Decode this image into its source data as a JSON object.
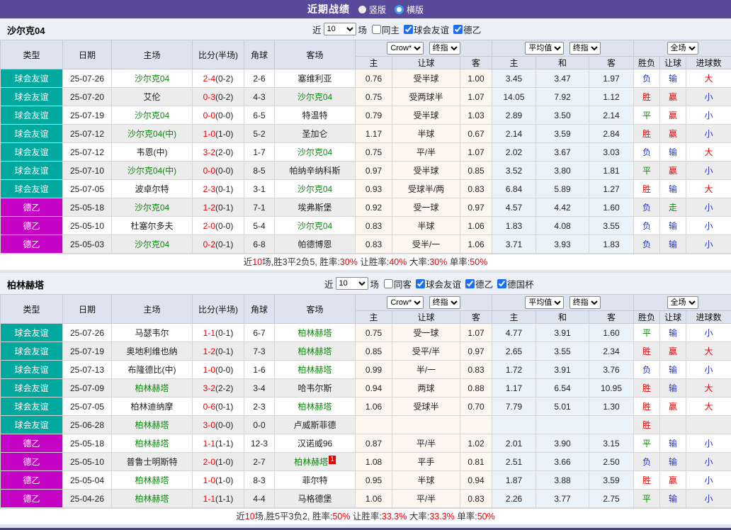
{
  "topbar": {
    "title": "近期战绩",
    "radio_vertical": "竖版",
    "radio_horizontal": "横版"
  },
  "controls": {
    "near_label": "近",
    "games_label": "场"
  },
  "table_header": {
    "cols": [
      "类型",
      "日期",
      "主场",
      "比分(半场)",
      "角球",
      "客场"
    ],
    "sub": [
      "主",
      "让球",
      "客",
      "主",
      "和",
      "客",
      "胜负",
      "让球",
      "进球数"
    ],
    "selects": {
      "provider": "Crow*",
      "final1": "终指",
      "average": "平均值",
      "final2": "终指",
      "scope": "全场"
    }
  },
  "league_colors": {
    "球会友谊": "#00a89d",
    "德乙": "#c503c5"
  },
  "result_colors": {
    "胜": "#e60000",
    "赢": "#e60000",
    "大": "#e60000",
    "负": "#2233cc",
    "输": "#2233cc",
    "小": "#2233cc",
    "平": "#088a08",
    "走": "#088a08"
  },
  "sections": [
    {
      "team": "沙尔克04",
      "recent_count": "10",
      "filters": [
        {
          "label": "同主",
          "checked": false
        },
        {
          "label": "球会友谊",
          "checked": true
        },
        {
          "label": "德乙",
          "checked": true
        }
      ],
      "rows": [
        {
          "league": "球会友谊",
          "date": "25-07-26",
          "home": "沙尔克04",
          "hg": true,
          "score": "2-4",
          "half": "(0-2)",
          "corner": "2-6",
          "away": "塞维利亚",
          "ag": false,
          "odds": [
            "0.76",
            "受半球",
            "1.00",
            "3.45",
            "3.47",
            "1.97"
          ],
          "res": [
            "负",
            "输",
            "大"
          ]
        },
        {
          "league": "球会友谊",
          "date": "25-07-20",
          "home": "艾伦",
          "hg": false,
          "score": "0-3",
          "half": "(0-2)",
          "corner": "4-3",
          "away": "沙尔克04",
          "ag": true,
          "odds": [
            "0.75",
            "受两球半",
            "1.07",
            "14.05",
            "7.92",
            "1.12"
          ],
          "res": [
            "胜",
            "赢",
            "小"
          ]
        },
        {
          "league": "球会友谊",
          "date": "25-07-19",
          "home": "沙尔克04",
          "hg": true,
          "score": "0-0",
          "half": "(0-0)",
          "corner": "6-5",
          "away": "特温特",
          "ag": false,
          "odds": [
            "0.79",
            "受半球",
            "1.03",
            "2.89",
            "3.50",
            "2.14"
          ],
          "res": [
            "平",
            "赢",
            "小"
          ]
        },
        {
          "league": "球会友谊",
          "date": "25-07-12",
          "home": "沙尔克04(中)",
          "hg": true,
          "score": "1-0",
          "half": "(1-0)",
          "corner": "5-2",
          "away": "圣加仑",
          "ag": false,
          "odds": [
            "1.17",
            "半球",
            "0.67",
            "2.14",
            "3.59",
            "2.84"
          ],
          "res": [
            "胜",
            "赢",
            "小"
          ]
        },
        {
          "league": "球会友谊",
          "date": "25-07-12",
          "home": "韦恩(中)",
          "hg": false,
          "score": "3-2",
          "half": "(2-0)",
          "corner": "1-7",
          "away": "沙尔克04",
          "ag": true,
          "odds": [
            "0.75",
            "平/半",
            "1.07",
            "2.02",
            "3.67",
            "3.03"
          ],
          "res": [
            "负",
            "输",
            "大"
          ]
        },
        {
          "league": "球会友谊",
          "date": "25-07-10",
          "home": "沙尔克04(中)",
          "hg": true,
          "score": "0-0",
          "half": "(0-0)",
          "corner": "8-5",
          "away": "帕纳辛纳科斯",
          "ag": false,
          "odds": [
            "0.97",
            "受半球",
            "0.85",
            "3.52",
            "3.80",
            "1.81"
          ],
          "res": [
            "平",
            "赢",
            "小"
          ]
        },
        {
          "league": "球会友谊",
          "date": "25-07-05",
          "home": "波卓尔特",
          "hg": false,
          "score": "2-3",
          "half": "(0-1)",
          "corner": "3-1",
          "away": "沙尔克04",
          "ag": true,
          "odds": [
            "0.93",
            "受球半/两",
            "0.83",
            "6.84",
            "5.89",
            "1.27"
          ],
          "res": [
            "胜",
            "输",
            "大"
          ]
        },
        {
          "league": "德乙",
          "date": "25-05-18",
          "home": "沙尔克04",
          "hg": true,
          "score": "1-2",
          "half": "(0-1)",
          "corner": "7-1",
          "away": "埃弗斯堡",
          "ag": false,
          "odds": [
            "0.92",
            "受一球",
            "0.97",
            "4.57",
            "4.42",
            "1.60"
          ],
          "res": [
            "负",
            "走",
            "小"
          ]
        },
        {
          "league": "德乙",
          "date": "25-05-10",
          "home": "杜塞尔多夫",
          "hg": false,
          "score": "2-0",
          "half": "(0-0)",
          "corner": "5-4",
          "away": "沙尔克04",
          "ag": true,
          "odds": [
            "0.83",
            "半球",
            "1.06",
            "1.83",
            "4.08",
            "3.55"
          ],
          "res": [
            "负",
            "输",
            "小"
          ]
        },
        {
          "league": "德乙",
          "date": "25-05-03",
          "home": "沙尔克04",
          "hg": true,
          "score": "0-2",
          "half": "(0-1)",
          "corner": "6-8",
          "away": "帕德博恩",
          "ag": false,
          "odds": [
            "0.83",
            "受半/一",
            "1.06",
            "3.71",
            "3.93",
            "1.83"
          ],
          "res": [
            "负",
            "输",
            "小"
          ]
        }
      ],
      "summary": [
        [
          "近",
          0
        ],
        [
          "10",
          1
        ],
        [
          "场,胜3平2负5, 胜率:",
          0
        ],
        [
          "30%",
          1
        ],
        [
          " 让胜率:",
          0
        ],
        [
          "40%",
          1
        ],
        [
          " 大率:",
          0
        ],
        [
          "30%",
          1
        ],
        [
          " 单率:",
          0
        ],
        [
          "50%",
          1
        ]
      ]
    },
    {
      "team": "柏林赫塔",
      "recent_count": "10",
      "filters": [
        {
          "label": "同客",
          "checked": false
        },
        {
          "label": "球会友谊",
          "checked": true
        },
        {
          "label": "德乙",
          "checked": true
        },
        {
          "label": "德国杯",
          "checked": true
        }
      ],
      "rows": [
        {
          "league": "球会友谊",
          "date": "25-07-26",
          "home": "马瑟韦尔",
          "hg": false,
          "score": "1-1",
          "half": "(0-1)",
          "corner": "6-7",
          "away": "柏林赫塔",
          "ag": true,
          "odds": [
            "0.75",
            "受一球",
            "1.07",
            "4.77",
            "3.91",
            "1.60"
          ],
          "res": [
            "平",
            "输",
            "小"
          ]
        },
        {
          "league": "球会友谊",
          "date": "25-07-19",
          "home": "奥地利维也纳",
          "hg": false,
          "score": "1-2",
          "half": "(0-1)",
          "corner": "7-3",
          "away": "柏林赫塔",
          "ag": true,
          "odds": [
            "0.85",
            "受平/半",
            "0.97",
            "2.65",
            "3.55",
            "2.34"
          ],
          "res": [
            "胜",
            "赢",
            "大"
          ]
        },
        {
          "league": "球会友谊",
          "date": "25-07-13",
          "home": "布隆德比(中)",
          "hg": false,
          "score": "1-0",
          "half": "(0-0)",
          "corner": "1-6",
          "away": "柏林赫塔",
          "ag": true,
          "odds": [
            "0.99",
            "半/一",
            "0.83",
            "1.72",
            "3.91",
            "3.76"
          ],
          "res": [
            "负",
            "输",
            "小"
          ]
        },
        {
          "league": "球会友谊",
          "date": "25-07-09",
          "home": "柏林赫塔",
          "hg": true,
          "score": "3-2",
          "half": "(2-2)",
          "corner": "3-4",
          "away": "哈韦尔斯",
          "ag": false,
          "odds": [
            "0.94",
            "两球",
            "0.88",
            "1.17",
            "6.54",
            "10.95"
          ],
          "res": [
            "胜",
            "输",
            "大"
          ]
        },
        {
          "league": "球会友谊",
          "date": "25-07-05",
          "home": "柏林迪纳摩",
          "hg": false,
          "score": "0-6",
          "half": "(0-1)",
          "corner": "2-3",
          "away": "柏林赫塔",
          "ag": true,
          "odds": [
            "1.06",
            "受球半",
            "0.70",
            "7.79",
            "5.01",
            "1.30"
          ],
          "res": [
            "胜",
            "赢",
            "大"
          ]
        },
        {
          "league": "球会友谊",
          "date": "25-06-28",
          "home": "柏林赫塔",
          "hg": true,
          "score": "3-0",
          "half": "(0-0)",
          "corner": "0-0",
          "away": "卢威斯菲德",
          "ag": false,
          "odds": [
            "",
            "",
            "",
            "",
            "",
            ""
          ],
          "res": [
            "胜",
            "",
            ""
          ]
        },
        {
          "league": "德乙",
          "date": "25-05-18",
          "home": "柏林赫塔",
          "hg": true,
          "score": "1-1",
          "half": "(1-1)",
          "corner": "12-3",
          "away": "汉诺威96",
          "ag": false,
          "odds": [
            "0.87",
            "平/半",
            "1.02",
            "2.01",
            "3.90",
            "3.15"
          ],
          "res": [
            "平",
            "输",
            "小"
          ]
        },
        {
          "league": "德乙",
          "date": "25-05-10",
          "home": "普鲁士明斯特",
          "hg": false,
          "score": "2-0",
          "half": "(1-0)",
          "corner": "2-7",
          "away": "柏林赫塔",
          "ag": true,
          "away_rc": "1",
          "odds": [
            "1.08",
            "平手",
            "0.81",
            "2.51",
            "3.66",
            "2.50"
          ],
          "res": [
            "负",
            "输",
            "小"
          ]
        },
        {
          "league": "德乙",
          "date": "25-05-04",
          "home": "柏林赫塔",
          "hg": true,
          "score": "1-0",
          "half": "(1-0)",
          "corner": "8-3",
          "away": "菲尔特",
          "ag": false,
          "odds": [
            "0.95",
            "半球",
            "0.94",
            "1.87",
            "3.88",
            "3.59"
          ],
          "res": [
            "胜",
            "赢",
            "小"
          ]
        },
        {
          "league": "德乙",
          "date": "25-04-26",
          "home": "柏林赫塔",
          "hg": true,
          "score": "1-1",
          "half": "(1-1)",
          "corner": "4-4",
          "away": "马格德堡",
          "ag": false,
          "odds": [
            "1.06",
            "平/半",
            "0.83",
            "2.26",
            "3.77",
            "2.75"
          ],
          "res": [
            "平",
            "输",
            "小"
          ]
        }
      ],
      "summary": [
        [
          "近",
          0
        ],
        [
          "10",
          1
        ],
        [
          "场,胜5平3负2, 胜率:",
          0
        ],
        [
          "50%",
          1
        ],
        [
          " 让胜率:",
          0
        ],
        [
          "33.3%",
          1
        ],
        [
          " 大率:",
          0
        ],
        [
          "33.3%",
          1
        ],
        [
          " 单率:",
          0
        ],
        [
          "50%",
          1
        ]
      ]
    }
  ]
}
